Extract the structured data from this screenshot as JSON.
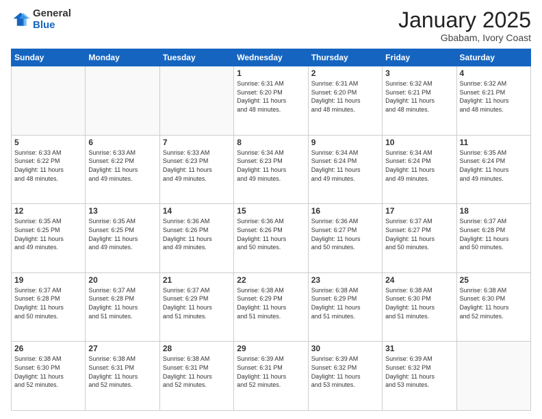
{
  "logo": {
    "general": "General",
    "blue": "Blue"
  },
  "header": {
    "month": "January 2025",
    "location": "Gbabam, Ivory Coast"
  },
  "weekdays": [
    "Sunday",
    "Monday",
    "Tuesday",
    "Wednesday",
    "Thursday",
    "Friday",
    "Saturday"
  ],
  "weeks": [
    [
      {
        "day": "",
        "info": ""
      },
      {
        "day": "",
        "info": ""
      },
      {
        "day": "",
        "info": ""
      },
      {
        "day": "1",
        "info": "Sunrise: 6:31 AM\nSunset: 6:20 PM\nDaylight: 11 hours\nand 48 minutes."
      },
      {
        "day": "2",
        "info": "Sunrise: 6:31 AM\nSunset: 6:20 PM\nDaylight: 11 hours\nand 48 minutes."
      },
      {
        "day": "3",
        "info": "Sunrise: 6:32 AM\nSunset: 6:21 PM\nDaylight: 11 hours\nand 48 minutes."
      },
      {
        "day": "4",
        "info": "Sunrise: 6:32 AM\nSunset: 6:21 PM\nDaylight: 11 hours\nand 48 minutes."
      }
    ],
    [
      {
        "day": "5",
        "info": "Sunrise: 6:33 AM\nSunset: 6:22 PM\nDaylight: 11 hours\nand 48 minutes."
      },
      {
        "day": "6",
        "info": "Sunrise: 6:33 AM\nSunset: 6:22 PM\nDaylight: 11 hours\nand 49 minutes."
      },
      {
        "day": "7",
        "info": "Sunrise: 6:33 AM\nSunset: 6:23 PM\nDaylight: 11 hours\nand 49 minutes."
      },
      {
        "day": "8",
        "info": "Sunrise: 6:34 AM\nSunset: 6:23 PM\nDaylight: 11 hours\nand 49 minutes."
      },
      {
        "day": "9",
        "info": "Sunrise: 6:34 AM\nSunset: 6:24 PM\nDaylight: 11 hours\nand 49 minutes."
      },
      {
        "day": "10",
        "info": "Sunrise: 6:34 AM\nSunset: 6:24 PM\nDaylight: 11 hours\nand 49 minutes."
      },
      {
        "day": "11",
        "info": "Sunrise: 6:35 AM\nSunset: 6:24 PM\nDaylight: 11 hours\nand 49 minutes."
      }
    ],
    [
      {
        "day": "12",
        "info": "Sunrise: 6:35 AM\nSunset: 6:25 PM\nDaylight: 11 hours\nand 49 minutes."
      },
      {
        "day": "13",
        "info": "Sunrise: 6:35 AM\nSunset: 6:25 PM\nDaylight: 11 hours\nand 49 minutes."
      },
      {
        "day": "14",
        "info": "Sunrise: 6:36 AM\nSunset: 6:26 PM\nDaylight: 11 hours\nand 49 minutes."
      },
      {
        "day": "15",
        "info": "Sunrise: 6:36 AM\nSunset: 6:26 PM\nDaylight: 11 hours\nand 50 minutes."
      },
      {
        "day": "16",
        "info": "Sunrise: 6:36 AM\nSunset: 6:27 PM\nDaylight: 11 hours\nand 50 minutes."
      },
      {
        "day": "17",
        "info": "Sunrise: 6:37 AM\nSunset: 6:27 PM\nDaylight: 11 hours\nand 50 minutes."
      },
      {
        "day": "18",
        "info": "Sunrise: 6:37 AM\nSunset: 6:28 PM\nDaylight: 11 hours\nand 50 minutes."
      }
    ],
    [
      {
        "day": "19",
        "info": "Sunrise: 6:37 AM\nSunset: 6:28 PM\nDaylight: 11 hours\nand 50 minutes."
      },
      {
        "day": "20",
        "info": "Sunrise: 6:37 AM\nSunset: 6:28 PM\nDaylight: 11 hours\nand 51 minutes."
      },
      {
        "day": "21",
        "info": "Sunrise: 6:37 AM\nSunset: 6:29 PM\nDaylight: 11 hours\nand 51 minutes."
      },
      {
        "day": "22",
        "info": "Sunrise: 6:38 AM\nSunset: 6:29 PM\nDaylight: 11 hours\nand 51 minutes."
      },
      {
        "day": "23",
        "info": "Sunrise: 6:38 AM\nSunset: 6:29 PM\nDaylight: 11 hours\nand 51 minutes."
      },
      {
        "day": "24",
        "info": "Sunrise: 6:38 AM\nSunset: 6:30 PM\nDaylight: 11 hours\nand 51 minutes."
      },
      {
        "day": "25",
        "info": "Sunrise: 6:38 AM\nSunset: 6:30 PM\nDaylight: 11 hours\nand 52 minutes."
      }
    ],
    [
      {
        "day": "26",
        "info": "Sunrise: 6:38 AM\nSunset: 6:30 PM\nDaylight: 11 hours\nand 52 minutes."
      },
      {
        "day": "27",
        "info": "Sunrise: 6:38 AM\nSunset: 6:31 PM\nDaylight: 11 hours\nand 52 minutes."
      },
      {
        "day": "28",
        "info": "Sunrise: 6:38 AM\nSunset: 6:31 PM\nDaylight: 11 hours\nand 52 minutes."
      },
      {
        "day": "29",
        "info": "Sunrise: 6:39 AM\nSunset: 6:31 PM\nDaylight: 11 hours\nand 52 minutes."
      },
      {
        "day": "30",
        "info": "Sunrise: 6:39 AM\nSunset: 6:32 PM\nDaylight: 11 hours\nand 53 minutes."
      },
      {
        "day": "31",
        "info": "Sunrise: 6:39 AM\nSunset: 6:32 PM\nDaylight: 11 hours\nand 53 minutes."
      },
      {
        "day": "",
        "info": ""
      }
    ]
  ]
}
